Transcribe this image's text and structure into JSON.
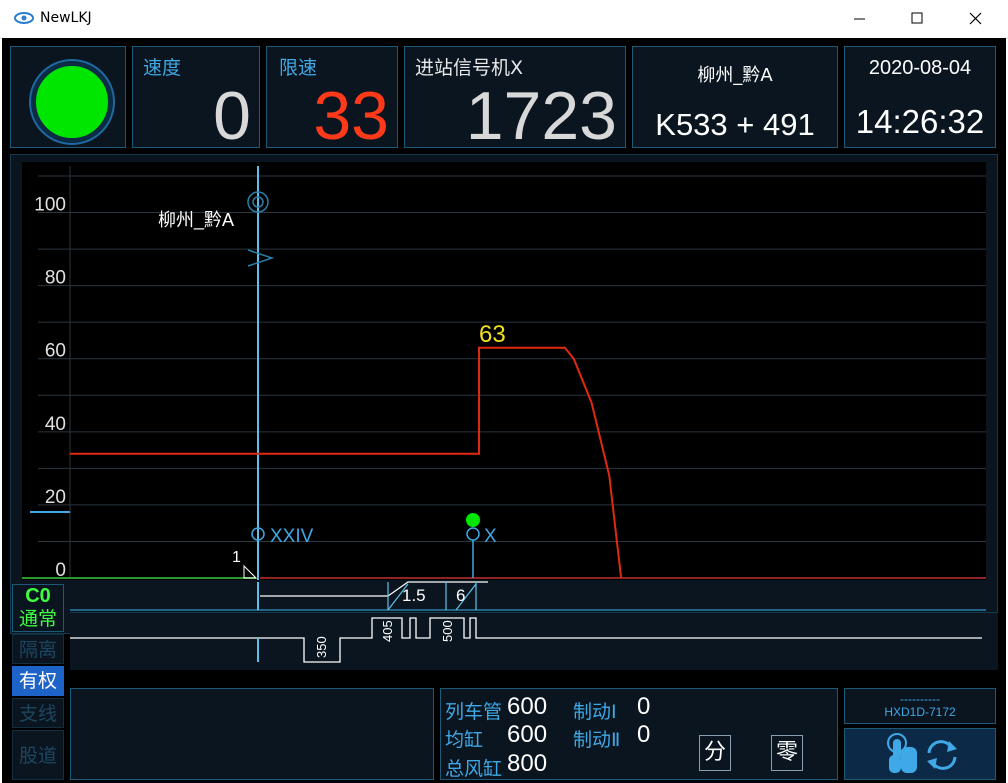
{
  "window": {
    "title": "NewLKJ"
  },
  "signal_lamp": {
    "color": "#00e600"
  },
  "speed": {
    "label": "速度",
    "value": "0"
  },
  "limit": {
    "label": "限速",
    "value": "33"
  },
  "signal": {
    "label": "进站信号机X",
    "value": "1723"
  },
  "station": {
    "name": "柳州_黔A",
    "km": "K533 + 491"
  },
  "datetime": {
    "date": "2020-08-04",
    "time": "14:26:32"
  },
  "chart": {
    "y_ticks": [
      "100",
      "80",
      "60",
      "40",
      "20",
      "0"
    ],
    "station_label": "柳州_黔A",
    "peak_label": "63",
    "signal_left_label": "XXIV",
    "signal_right_label": "X",
    "marker_label": "1",
    "gradient_labels": [
      "1.5",
      "6"
    ],
    "curve_labels": [
      "350",
      "405",
      "500"
    ]
  },
  "chart_data": {
    "type": "line",
    "series": [
      {
        "values": [
          [
            0,
            34
          ],
          [
            0,
            34
          ],
          [
            74,
            34
          ],
          [
            74,
            63
          ],
          [
            103,
            63
          ],
          [
            106,
            60
          ],
          [
            112,
            48
          ],
          [
            118,
            28
          ],
          [
            122,
            0
          ]
        ]
      }
    ],
    "ylim": [
      0,
      110
    ],
    "yticks": [
      0,
      20,
      40,
      60,
      80,
      100
    ],
    "annotations": [
      "63"
    ]
  },
  "mode": {
    "code": "C0",
    "state": "通常"
  },
  "side_buttons": [
    "隔离",
    "有权",
    "支线",
    "股道"
  ],
  "brake": {
    "train_pipe_label": "列车管",
    "train_pipe_value": "600",
    "equalizing_label": "均缸",
    "equalizing_value": "600",
    "main_reservoir_label": "总风缸",
    "main_reservoir_value": "800",
    "brake1_label": "制动Ⅰ",
    "brake1_value": "0",
    "brake2_label": "制动Ⅱ",
    "brake2_value": "0"
  },
  "buttons": {
    "fen": "分",
    "ling": "零"
  },
  "loco": {
    "dashes": "----------",
    "id": "HXD1D-7172"
  },
  "colors": {
    "accent": "#3fa8e6",
    "limit": "#ff3a1a",
    "curve": "#e02a10",
    "lamp": "#00e600",
    "peak": "#f0e020"
  }
}
